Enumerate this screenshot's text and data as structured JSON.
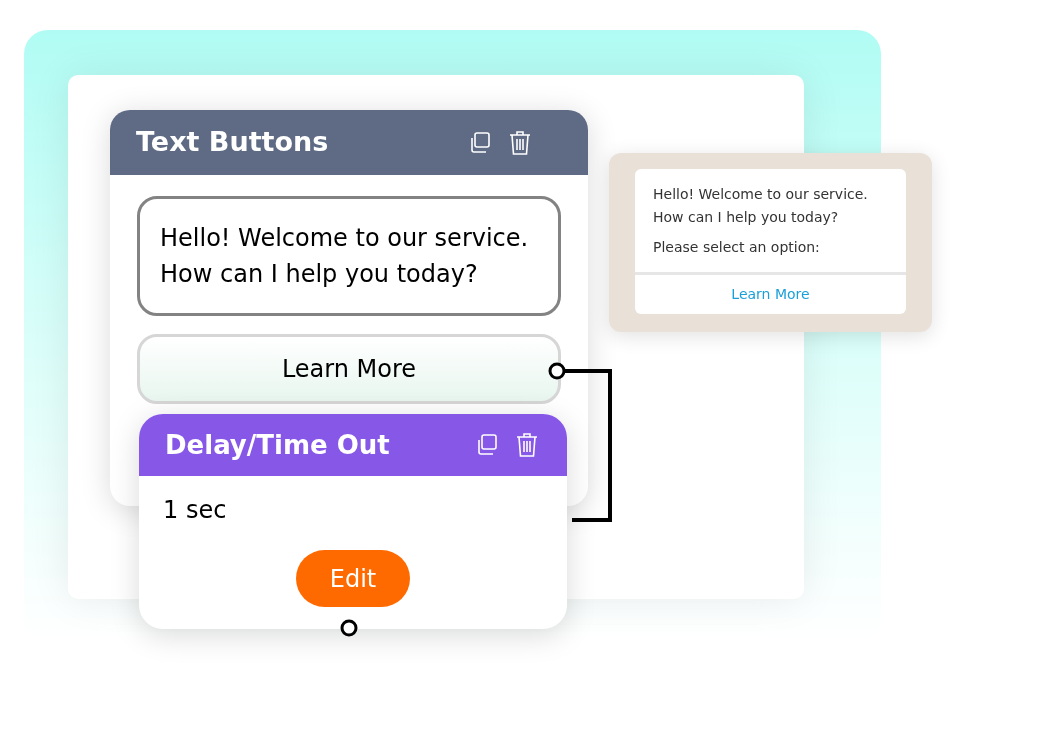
{
  "text_buttons_card": {
    "title": "Text Buttons",
    "message_lines": [
      "Hello! Welcome to our service.",
      "How can I help you today?"
    ],
    "button": "Learn More"
  },
  "delay_card": {
    "title": "Delay/Time Out",
    "duration": "1 sec",
    "button": "Edit"
  },
  "chat_preview": {
    "message_lines": [
      "Hello! Welcome to our service.",
      "How can I help you today?"
    ],
    "prompt": "Please select an option:",
    "button": "Learn More"
  }
}
